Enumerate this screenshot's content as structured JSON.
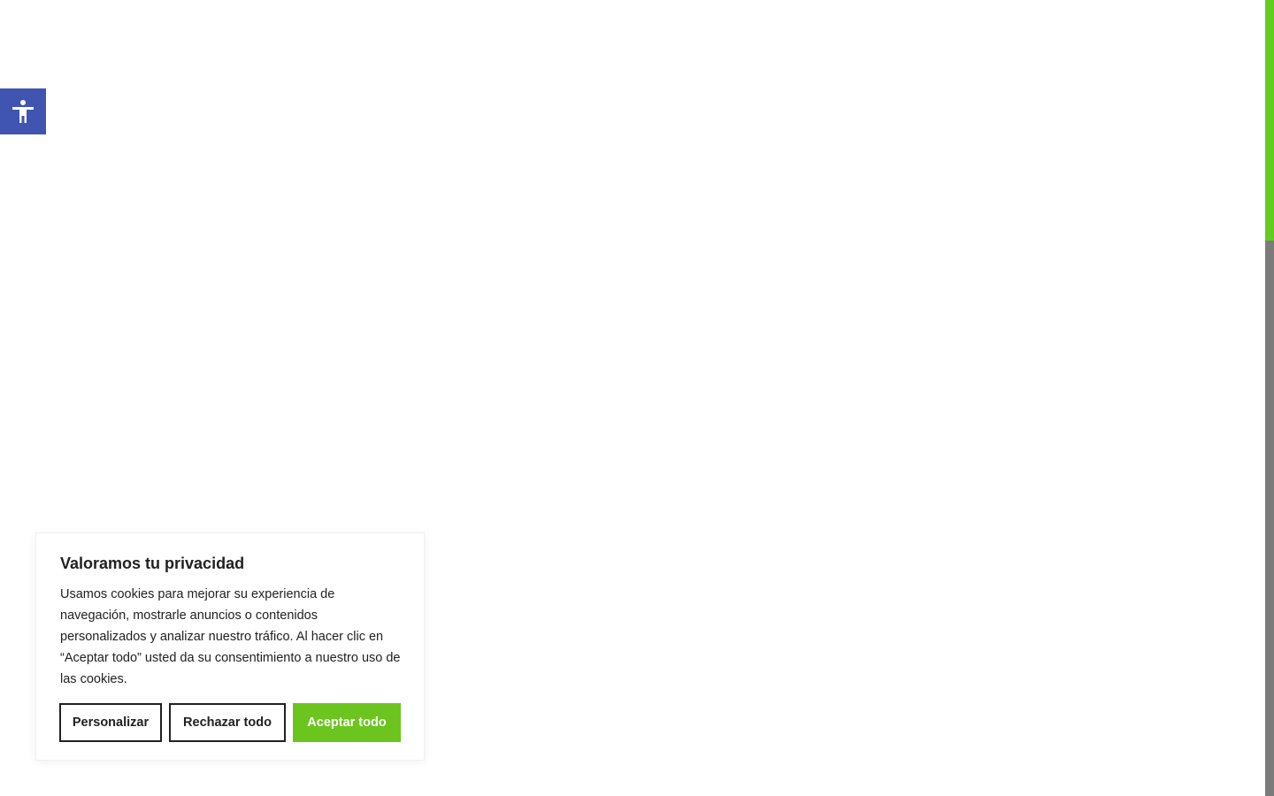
{
  "accessibility": {
    "icon": "accessibility-icon",
    "color": "#4054b2"
  },
  "scrollbar": {
    "track_color": "#7b7b7b",
    "thumb_color": "#61ce1f"
  },
  "cookie_banner": {
    "title": "Valoramos tu privacidad",
    "text": "Usamos cookies para mejorar su experiencia de navegación, mostrarle anuncios o contenidos personalizados y analizar nuestro tráfico. Al hacer clic en “Aceptar todo” usted da su consentimiento a nuestro uso de las cookies.",
    "buttons": {
      "customize": "Personalizar",
      "reject": "Rechazar todo",
      "accept": "Aceptar todo"
    },
    "accent_color": "#6cc51f"
  }
}
